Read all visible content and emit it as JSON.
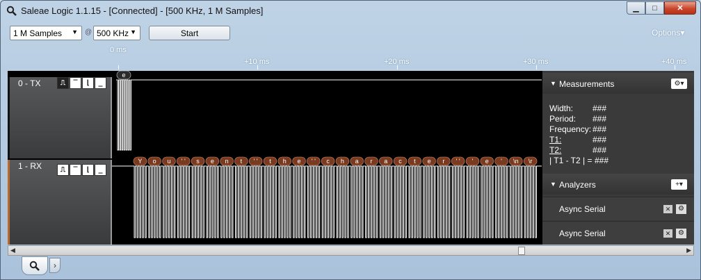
{
  "window": {
    "title": "Saleae Logic 1.1.15 - [Connected] - [500 KHz, 1 M Samples]",
    "min_glyph": "▁",
    "max_glyph": "□",
    "close_glyph": "✕"
  },
  "toolbar": {
    "samples_value": "1 M Samples",
    "at_glyph": "@",
    "rate_value": "500 KHz",
    "start_label": "Start",
    "options_label": "Options▾"
  },
  "ruler": {
    "labels": [
      "0 ms",
      "+10 ms",
      "+20 ms",
      "+30 ms",
      "+40 ms"
    ]
  },
  "channels": [
    {
      "label": "0 - TX",
      "protocol_chars": [
        "e"
      ]
    },
    {
      "label": "1 - RX",
      "protocol_chars": [
        "Y",
        "o",
        "u",
        "' '",
        "s",
        "e",
        "n",
        "t",
        "' '",
        "t",
        "h",
        "e",
        "' '",
        "c",
        "h",
        "a",
        "r",
        "a",
        "c",
        "t",
        "e",
        "r",
        "' '",
        "'",
        "e",
        "'",
        "\\n",
        "\\r"
      ]
    }
  ],
  "trigger_glyphs": [
    "⎍",
    "‾",
    "⌊",
    "_"
  ],
  "measurements": {
    "title": "Measurements",
    "rows": [
      {
        "label": "Width:",
        "value": "###"
      },
      {
        "label": "Period:",
        "value": "###"
      },
      {
        "label": "Frequency:",
        "value": "###"
      },
      {
        "label": "T1:",
        "value": "###"
      },
      {
        "label": "T2:",
        "value": "###"
      },
      {
        "label": "| T1 - T2 | =",
        "value": "###"
      }
    ]
  },
  "analyzers": {
    "title": "Analyzers",
    "add_glyph": "+▾",
    "items": [
      {
        "name": "Async Serial"
      },
      {
        "name": "Async Serial"
      }
    ]
  },
  "colors": {
    "rx_accent": "#b96a2b",
    "bubble": "#7a3a20",
    "trace": "#ffffff",
    "panel_bg": "#000000"
  }
}
